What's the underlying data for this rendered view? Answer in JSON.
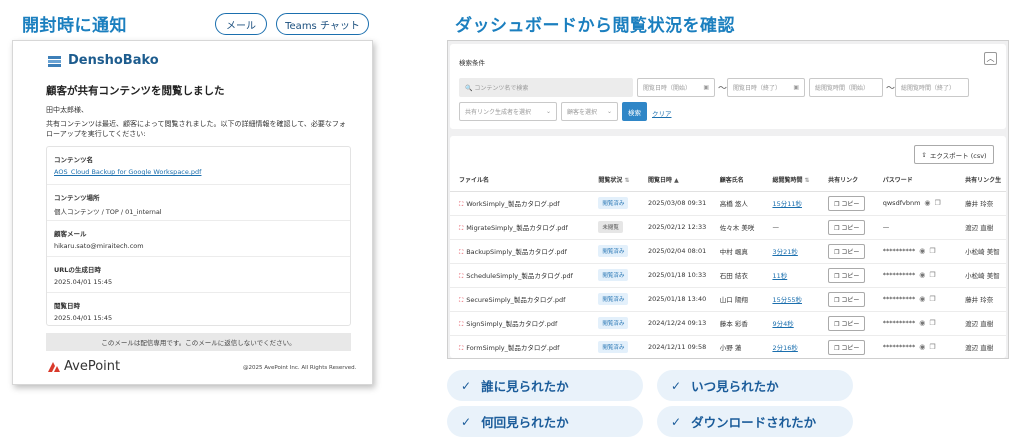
{
  "left_header": "開封時に通知",
  "channels": [
    "メール",
    "Teams チャット"
  ],
  "right_header": "ダッシュボードから閲覧状況を確認",
  "email": {
    "logo_text": "DenshoBako",
    "title": "顧客が共有コンテンツを閲覧しました",
    "greeting": "田中太郎様、",
    "body": "共有コンテンツは最近、顧客によって閲覧されました。以下の詳細情報を確認して、必要なフォローアップを実行してください:",
    "fields": [
      {
        "label": "コンテンツ名",
        "value": "AOS_Cloud Backup for Google Workspace.pdf"
      },
      {
        "label": "コンテンツ場所",
        "value": "個人コンテンツ / TOP / 01_internal"
      },
      {
        "label": "顧客メール",
        "value": "hikaru.sato@miraitech.com"
      },
      {
        "label": "URLの生成日時",
        "value": "2025.04/01 15:45"
      },
      {
        "label": "閲覧日時",
        "value": "2025.04/01 15:45"
      }
    ],
    "notice": "このメールは配信専用です。このメールに返信しないでください。",
    "footer_logo": "AvePoint",
    "copyright": "@2025 AvePoint Inc. All Rights Reserved."
  },
  "dashboard": {
    "search_title": "検索条件",
    "collapse_icon": "chevron-up-icon",
    "content_placeholder": "コンテンツ名で検索",
    "view_start": "閲覧日時（開始）",
    "view_end": "閲覧日時（終了）",
    "time_start": "総閲覧時間（開始）",
    "time_end": "総閲覧時間（終了）",
    "tilde": "〜",
    "creator_select": "共有リンク生成者を選択",
    "customer_select": "顧客を選択",
    "search_button": "検索",
    "clear_link": "クリア",
    "export_button": "エクスポート (csv)",
    "columns": [
      "ファイル名",
      "閲覧状況",
      "閲覧日時",
      "顧客氏名",
      "総閲覧時間",
      "共有リンク",
      "パスワード",
      "共有リンク生"
    ],
    "copy_label": "コピー",
    "rows": [
      {
        "file": "WorkSimply_製品カタログ.pdf",
        "status": "閲覧済み",
        "seen": true,
        "date": "2025/03/08 09:31",
        "customer": "高橋 悠人",
        "duration": "15分11秒",
        "password": "qwsdfvbnm",
        "creator": "藤井 玲奈"
      },
      {
        "file": "MigrateSimply_製品カタログ.pdf",
        "status": "未閲覧",
        "seen": false,
        "date": "2025/02/12 12:33",
        "customer": "佐々木 美咲",
        "duration": "—",
        "password": "—",
        "creator": "渡辺 直樹"
      },
      {
        "file": "BackupSimply_製品カタログ.pdf",
        "status": "閲覧済み",
        "seen": true,
        "date": "2025/02/04 08:01",
        "customer": "中村 颯真",
        "duration": "3分21秒",
        "password": "**********",
        "creator": "小松崎 美智"
      },
      {
        "file": "ScheduleSimply_製品カタログ.pdf",
        "status": "閲覧済み",
        "seen": true,
        "date": "2025/01/18 10:33",
        "customer": "石田 結衣",
        "duration": "11秒",
        "password": "**********",
        "creator": "小松崎 美智"
      },
      {
        "file": "SecureSimply_製品カタログ.pdf",
        "status": "閲覧済み",
        "seen": true,
        "date": "2025/01/18 13:40",
        "customer": "山口 陽翔",
        "duration": "15分55秒",
        "password": "**********",
        "creator": "藤井 玲奈"
      },
      {
        "file": "SignSimply_製品カタログ.pdf",
        "status": "閲覧済み",
        "seen": true,
        "date": "2024/12/24 09:13",
        "customer": "藤本 彩香",
        "duration": "9分4秒",
        "password": "**********",
        "creator": "渡辺 直樹"
      },
      {
        "file": "FormSimply_製品カタログ.pdf",
        "status": "閲覧済み",
        "seen": true,
        "date": "2024/12/11 09:58",
        "customer": "小野 蓮",
        "duration": "2分16秒",
        "password": "**********",
        "creator": "渡辺 直樹"
      }
    ]
  },
  "checks": [
    "誰に見られたか",
    "いつ見られたか",
    "何回見られたか",
    "ダウンロードされたか"
  ]
}
